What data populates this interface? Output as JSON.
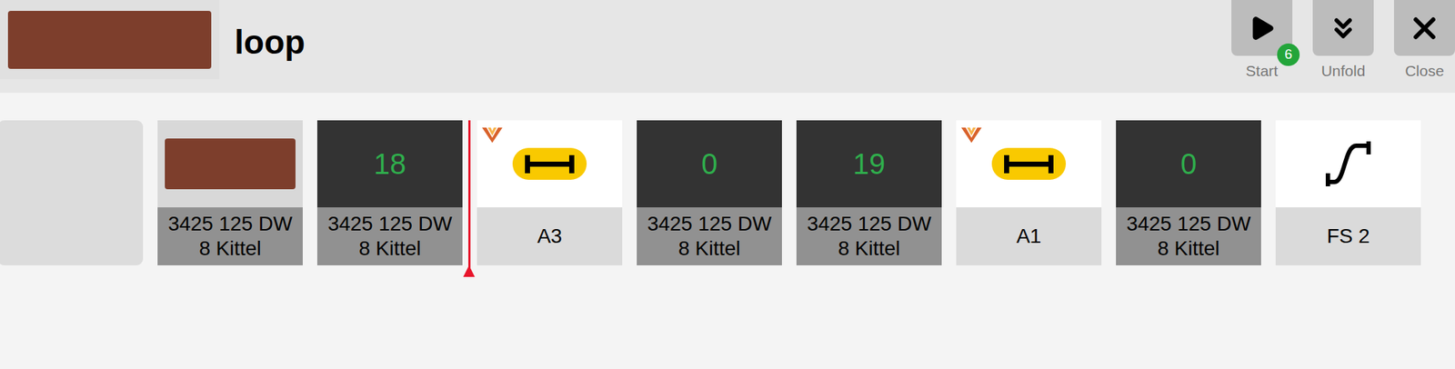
{
  "header": {
    "title": "loop",
    "buttons": [
      {
        "kind": "start",
        "label": "Start",
        "badge": "6"
      },
      {
        "kind": "unfold",
        "label": "Unfold"
      },
      {
        "kind": "close",
        "label": "Close"
      }
    ]
  },
  "sequence": [
    {
      "kind": "empty"
    },
    {
      "kind": "locomotive",
      "label": "3425 125 DW 8 Kittel"
    },
    {
      "kind": "count",
      "value": "18",
      "label": "3425 125 DW 8 Kittel"
    },
    {
      "kind": "track",
      "label": "A3",
      "flagged": true,
      "cursor": true
    },
    {
      "kind": "count",
      "value": "0",
      "label": "3425 125 DW 8 Kittel"
    },
    {
      "kind": "count",
      "value": "19",
      "label": "3425 125 DW 8 Kittel"
    },
    {
      "kind": "track",
      "label": "A1",
      "flagged": true
    },
    {
      "kind": "count",
      "value": "0",
      "label": "3425 125 DW 8 Kittel"
    },
    {
      "kind": "route",
      "label": "FS 2"
    }
  ]
}
